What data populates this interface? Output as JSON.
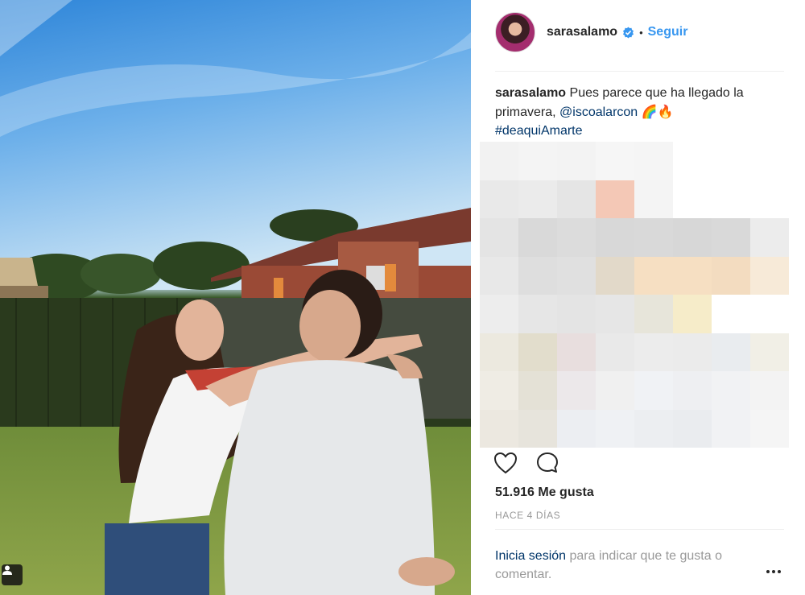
{
  "post": {
    "username": "sarasalamo",
    "verified_icon": "verified-badge-icon",
    "separator": "•",
    "follow_label": "Seguir",
    "caption": {
      "username": "sarasalamo",
      "text": "Pues parece que ha llegado la primavera,",
      "mention": "@iscoalarcon",
      "emojis": "🌈🔥",
      "hashtag": "#deaquiAmarte"
    },
    "likes": "51.916 Me gusta",
    "time": "HACE 4 DÍAS",
    "login_link": "Inicia sesión",
    "login_rest": "para indicar que te gusta o comentar.",
    "icons": [
      "heart-icon",
      "comment-icon",
      "more-options-icon",
      "user-tag-icon"
    ],
    "colors": {
      "link_blue": "#3897f0",
      "dark_link": "#003569",
      "text": "#262626",
      "muted": "#999999"
    }
  }
}
